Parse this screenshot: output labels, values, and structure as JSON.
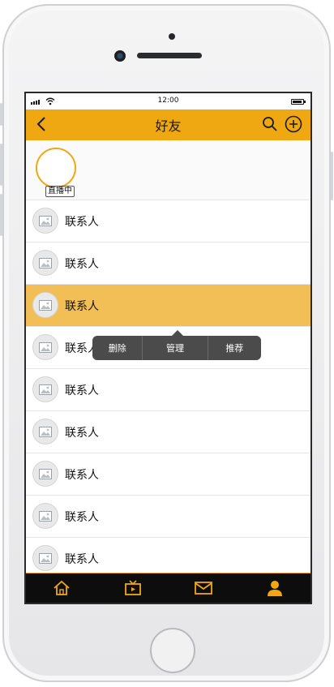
{
  "status_bar": {
    "time": "12:00"
  },
  "header": {
    "title": "好友"
  },
  "live": {
    "badge": "直播中"
  },
  "contacts": [
    {
      "name": "联系人"
    },
    {
      "name": "联系人"
    },
    {
      "name": "联系人",
      "selected": true
    },
    {
      "name": "联系人"
    },
    {
      "name": "联系人"
    },
    {
      "name": "联系人"
    },
    {
      "name": "联系人"
    },
    {
      "name": "联系人"
    },
    {
      "name": "联系人"
    }
  ],
  "context_menu": {
    "items": [
      "删除",
      "管理",
      "推荐"
    ]
  },
  "tabbar": {
    "icons": [
      "home-icon",
      "tv-icon",
      "mail-icon",
      "profile-icon"
    ]
  },
  "colors": {
    "accent": "#f0a812",
    "selected_row": "#f2bf56",
    "tabbar_bg": "#0d0d0d",
    "menu_bg": "#4b4b4b"
  }
}
